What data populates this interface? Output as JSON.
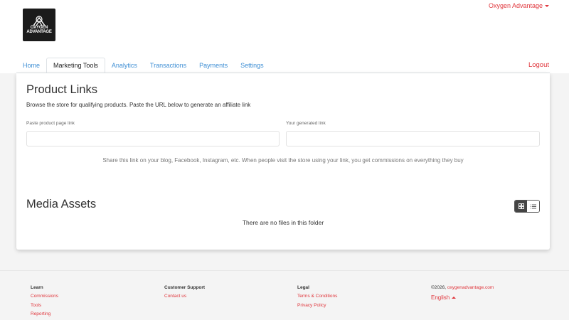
{
  "header": {
    "logo_text": "OXYGEN ADVANTAGE",
    "logo_line1": "OXYGEN",
    "logo_line2": "ADVANTAGE",
    "account_menu_label": "Oxygen Advantage",
    "logout_label": "Logout"
  },
  "tabs": [
    {
      "label": "Home",
      "active": false
    },
    {
      "label": "Marketing Tools",
      "active": true
    },
    {
      "label": "Analytics",
      "active": false
    },
    {
      "label": "Transactions",
      "active": false
    },
    {
      "label": "Payments",
      "active": false
    },
    {
      "label": "Settings",
      "active": false
    }
  ],
  "product_links": {
    "title": "Product Links",
    "description": "Browse the store for qualifying products. Paste the URL below to generate an affiliate link",
    "product_url_label": "Paste product page link",
    "product_url_value": "",
    "generated_link_label": "Your generated link",
    "generated_link_value": "",
    "share_text": "Share this link on your blog, Facebook, Instagram, etc. When people visit the store using your link, you get commissions on everything they buy"
  },
  "media_assets": {
    "title": "Media Assets",
    "view_mode": "grid",
    "grid_icon": "grid-icon",
    "list_icon": "list-icon",
    "empty_text": "There are no files in this folder"
  },
  "footer": {
    "learn": {
      "heading": "Learn",
      "links": [
        "Commissions",
        "Tools",
        "Reporting"
      ]
    },
    "support": {
      "heading": "Customer Support",
      "links": [
        "Contact us"
      ]
    },
    "legal": {
      "heading": "Legal",
      "links": [
        "Terms & Conditions",
        "Privacy Policy"
      ]
    },
    "copyright_prefix": "©2026, ",
    "copyright_link": "oxygenadvantage.com",
    "language": "English"
  },
  "colors": {
    "accent_red": "#e0363c",
    "tab_blue": "#3d8ed4",
    "toggle_active": "#444444"
  }
}
